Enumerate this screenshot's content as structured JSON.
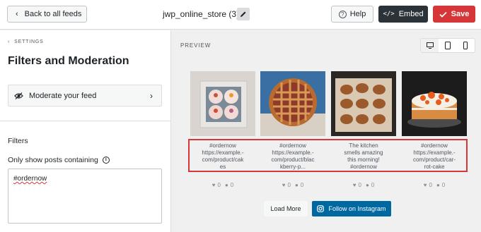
{
  "header": {
    "back_label": "Back to all feeds",
    "feed_title": "jwp_online_store (3)",
    "help_label": "Help",
    "embed_label": "Embed",
    "save_label": "Save"
  },
  "sidebar": {
    "breadcrumb": "SETTINGS",
    "title": "Filters and Moderation",
    "moderate_label": "Moderate your feed",
    "filters_heading": "Filters",
    "only_show_label": "Only show posts containing",
    "filter_value": "#ordernow"
  },
  "preview": {
    "label": "PREVIEW",
    "devices": [
      "desktop-icon",
      "tablet-icon",
      "mobile-icon"
    ],
    "posts": [
      {
        "caption": [
          "#ordernow",
          "https://example.-",
          "com/product/cak",
          "es"
        ],
        "likes": "0",
        "comments": "0"
      },
      {
        "caption": [
          "#ordernow",
          "https://example.-",
          "com/product/blac",
          "kberry-p..."
        ],
        "likes": "0",
        "comments": "0"
      },
      {
        "caption": [
          "The kitchen",
          "smells amazing",
          "this morning!",
          "#ordernow"
        ],
        "likes": "0",
        "comments": "0"
      },
      {
        "caption": [
          "#ordernow",
          "https://example.-",
          "com/product/car-",
          "rot-cake"
        ],
        "likes": "0",
        "comments": "0"
      }
    ],
    "load_more_label": "Load More",
    "follow_label": "Follow on Instagram"
  },
  "colors": {
    "save": "#d63638",
    "embed": "#2c3338",
    "follow": "#0068a0",
    "highlight": "#d63638"
  }
}
